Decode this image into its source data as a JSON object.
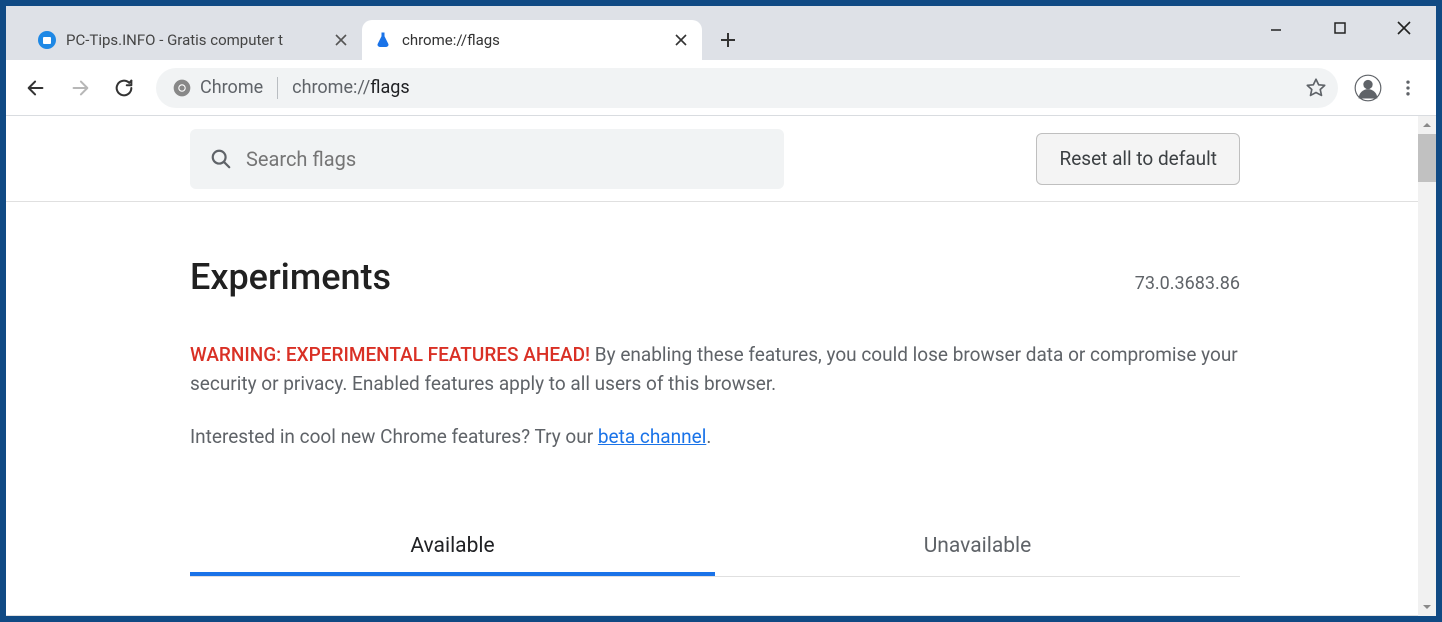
{
  "tabs": [
    {
      "title": "PC-Tips.INFO - Gratis computer t"
    },
    {
      "title": "chrome://flags"
    }
  ],
  "omnibox": {
    "chip_label": "Chrome",
    "url_prefix": "chrome://",
    "url_path": "flags"
  },
  "flags_page": {
    "search_placeholder": "Search flags",
    "reset_label": "Reset all to default",
    "heading": "Experiments",
    "version": "73.0.3683.86",
    "warning_label": "WARNING: EXPERIMENTAL FEATURES AHEAD!",
    "warning_text": " By enabling these features, you could lose browser data or compromise your security or privacy. Enabled features apply to all users of this browser.",
    "interest_text_prefix": "Interested in cool new Chrome features? Try our ",
    "interest_link": "beta channel",
    "interest_text_suffix": ".",
    "tab_available": "Available",
    "tab_unavailable": "Unavailable"
  }
}
